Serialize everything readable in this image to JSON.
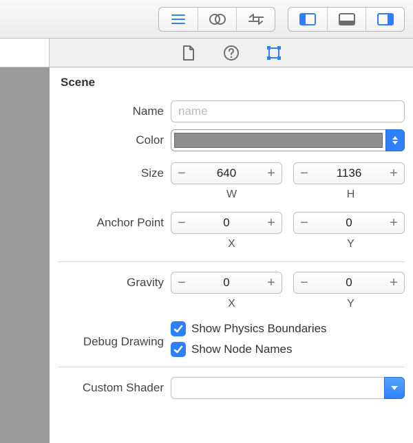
{
  "section_title": "Scene",
  "name": {
    "label": "Name",
    "value": "",
    "placeholder": "name"
  },
  "color": {
    "label": "Color",
    "swatch": "#8e8e8e"
  },
  "size": {
    "label": "Size",
    "w": {
      "value": "640",
      "sub": "W"
    },
    "h": {
      "value": "1136",
      "sub": "H"
    }
  },
  "anchor": {
    "label": "Anchor Point",
    "x": {
      "value": "0",
      "sub": "X"
    },
    "y": {
      "value": "0",
      "sub": "Y"
    }
  },
  "gravity": {
    "label": "Gravity",
    "x": {
      "value": "0",
      "sub": "X"
    },
    "y": {
      "value": "0",
      "sub": "Y"
    }
  },
  "debug": {
    "label": "Debug Drawing",
    "physics": {
      "checked": true,
      "label": "Show Physics Boundaries"
    },
    "names": {
      "checked": true,
      "label": "Show Node Names"
    }
  },
  "shader": {
    "label": "Custom Shader",
    "value": ""
  }
}
